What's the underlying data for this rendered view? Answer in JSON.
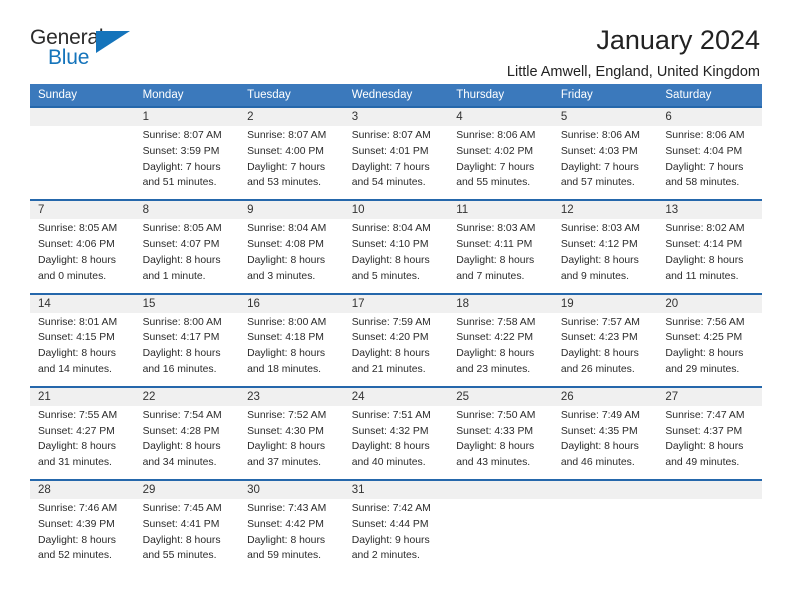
{
  "logo": {
    "primary_text": "General",
    "secondary_text": "Blue",
    "accent_color": "#1574bb"
  },
  "header": {
    "title": "January 2024",
    "subtitle": "Little Amwell, England, United Kingdom"
  },
  "colors": {
    "header_row_bg": "#3b79bc",
    "daynum_bg": "#f0f0f0",
    "week_separator": "#2567ab"
  },
  "calendar": {
    "day_headers": [
      "Sunday",
      "Monday",
      "Tuesday",
      "Wednesday",
      "Thursday",
      "Friday",
      "Saturday"
    ],
    "weeks": [
      [
        {
          "day": "",
          "sunrise": "",
          "sunset": "",
          "daylight": "",
          "daylight2": ""
        },
        {
          "day": "1",
          "sunrise": "Sunrise: 8:07 AM",
          "sunset": "Sunset: 3:59 PM",
          "daylight": "Daylight: 7 hours",
          "daylight2": "and 51 minutes."
        },
        {
          "day": "2",
          "sunrise": "Sunrise: 8:07 AM",
          "sunset": "Sunset: 4:00 PM",
          "daylight": "Daylight: 7 hours",
          "daylight2": "and 53 minutes."
        },
        {
          "day": "3",
          "sunrise": "Sunrise: 8:07 AM",
          "sunset": "Sunset: 4:01 PM",
          "daylight": "Daylight: 7 hours",
          "daylight2": "and 54 minutes."
        },
        {
          "day": "4",
          "sunrise": "Sunrise: 8:06 AM",
          "sunset": "Sunset: 4:02 PM",
          "daylight": "Daylight: 7 hours",
          "daylight2": "and 55 minutes."
        },
        {
          "day": "5",
          "sunrise": "Sunrise: 8:06 AM",
          "sunset": "Sunset: 4:03 PM",
          "daylight": "Daylight: 7 hours",
          "daylight2": "and 57 minutes."
        },
        {
          "day": "6",
          "sunrise": "Sunrise: 8:06 AM",
          "sunset": "Sunset: 4:04 PM",
          "daylight": "Daylight: 7 hours",
          "daylight2": "and 58 minutes."
        }
      ],
      [
        {
          "day": "7",
          "sunrise": "Sunrise: 8:05 AM",
          "sunset": "Sunset: 4:06 PM",
          "daylight": "Daylight: 8 hours",
          "daylight2": "and 0 minutes."
        },
        {
          "day": "8",
          "sunrise": "Sunrise: 8:05 AM",
          "sunset": "Sunset: 4:07 PM",
          "daylight": "Daylight: 8 hours",
          "daylight2": "and 1 minute."
        },
        {
          "day": "9",
          "sunrise": "Sunrise: 8:04 AM",
          "sunset": "Sunset: 4:08 PM",
          "daylight": "Daylight: 8 hours",
          "daylight2": "and 3 minutes."
        },
        {
          "day": "10",
          "sunrise": "Sunrise: 8:04 AM",
          "sunset": "Sunset: 4:10 PM",
          "daylight": "Daylight: 8 hours",
          "daylight2": "and 5 minutes."
        },
        {
          "day": "11",
          "sunrise": "Sunrise: 8:03 AM",
          "sunset": "Sunset: 4:11 PM",
          "daylight": "Daylight: 8 hours",
          "daylight2": "and 7 minutes."
        },
        {
          "day": "12",
          "sunrise": "Sunrise: 8:03 AM",
          "sunset": "Sunset: 4:12 PM",
          "daylight": "Daylight: 8 hours",
          "daylight2": "and 9 minutes."
        },
        {
          "day": "13",
          "sunrise": "Sunrise: 8:02 AM",
          "sunset": "Sunset: 4:14 PM",
          "daylight": "Daylight: 8 hours",
          "daylight2": "and 11 minutes."
        }
      ],
      [
        {
          "day": "14",
          "sunrise": "Sunrise: 8:01 AM",
          "sunset": "Sunset: 4:15 PM",
          "daylight": "Daylight: 8 hours",
          "daylight2": "and 14 minutes."
        },
        {
          "day": "15",
          "sunrise": "Sunrise: 8:00 AM",
          "sunset": "Sunset: 4:17 PM",
          "daylight": "Daylight: 8 hours",
          "daylight2": "and 16 minutes."
        },
        {
          "day": "16",
          "sunrise": "Sunrise: 8:00 AM",
          "sunset": "Sunset: 4:18 PM",
          "daylight": "Daylight: 8 hours",
          "daylight2": "and 18 minutes."
        },
        {
          "day": "17",
          "sunrise": "Sunrise: 7:59 AM",
          "sunset": "Sunset: 4:20 PM",
          "daylight": "Daylight: 8 hours",
          "daylight2": "and 21 minutes."
        },
        {
          "day": "18",
          "sunrise": "Sunrise: 7:58 AM",
          "sunset": "Sunset: 4:22 PM",
          "daylight": "Daylight: 8 hours",
          "daylight2": "and 23 minutes."
        },
        {
          "day": "19",
          "sunrise": "Sunrise: 7:57 AM",
          "sunset": "Sunset: 4:23 PM",
          "daylight": "Daylight: 8 hours",
          "daylight2": "and 26 minutes."
        },
        {
          "day": "20",
          "sunrise": "Sunrise: 7:56 AM",
          "sunset": "Sunset: 4:25 PM",
          "daylight": "Daylight: 8 hours",
          "daylight2": "and 29 minutes."
        }
      ],
      [
        {
          "day": "21",
          "sunrise": "Sunrise: 7:55 AM",
          "sunset": "Sunset: 4:27 PM",
          "daylight": "Daylight: 8 hours",
          "daylight2": "and 31 minutes."
        },
        {
          "day": "22",
          "sunrise": "Sunrise: 7:54 AM",
          "sunset": "Sunset: 4:28 PM",
          "daylight": "Daylight: 8 hours",
          "daylight2": "and 34 minutes."
        },
        {
          "day": "23",
          "sunrise": "Sunrise: 7:52 AM",
          "sunset": "Sunset: 4:30 PM",
          "daylight": "Daylight: 8 hours",
          "daylight2": "and 37 minutes."
        },
        {
          "day": "24",
          "sunrise": "Sunrise: 7:51 AM",
          "sunset": "Sunset: 4:32 PM",
          "daylight": "Daylight: 8 hours",
          "daylight2": "and 40 minutes."
        },
        {
          "day": "25",
          "sunrise": "Sunrise: 7:50 AM",
          "sunset": "Sunset: 4:33 PM",
          "daylight": "Daylight: 8 hours",
          "daylight2": "and 43 minutes."
        },
        {
          "day": "26",
          "sunrise": "Sunrise: 7:49 AM",
          "sunset": "Sunset: 4:35 PM",
          "daylight": "Daylight: 8 hours",
          "daylight2": "and 46 minutes."
        },
        {
          "day": "27",
          "sunrise": "Sunrise: 7:47 AM",
          "sunset": "Sunset: 4:37 PM",
          "daylight": "Daylight: 8 hours",
          "daylight2": "and 49 minutes."
        }
      ],
      [
        {
          "day": "28",
          "sunrise": "Sunrise: 7:46 AM",
          "sunset": "Sunset: 4:39 PM",
          "daylight": "Daylight: 8 hours",
          "daylight2": "and 52 minutes."
        },
        {
          "day": "29",
          "sunrise": "Sunrise: 7:45 AM",
          "sunset": "Sunset: 4:41 PM",
          "daylight": "Daylight: 8 hours",
          "daylight2": "and 55 minutes."
        },
        {
          "day": "30",
          "sunrise": "Sunrise: 7:43 AM",
          "sunset": "Sunset: 4:42 PM",
          "daylight": "Daylight: 8 hours",
          "daylight2": "and 59 minutes."
        },
        {
          "day": "31",
          "sunrise": "Sunrise: 7:42 AM",
          "sunset": "Sunset: 4:44 PM",
          "daylight": "Daylight: 9 hours",
          "daylight2": "and 2 minutes."
        },
        {
          "day": "",
          "sunrise": "",
          "sunset": "",
          "daylight": "",
          "daylight2": ""
        },
        {
          "day": "",
          "sunrise": "",
          "sunset": "",
          "daylight": "",
          "daylight2": ""
        },
        {
          "day": "",
          "sunrise": "",
          "sunset": "",
          "daylight": "",
          "daylight2": ""
        }
      ]
    ]
  }
}
